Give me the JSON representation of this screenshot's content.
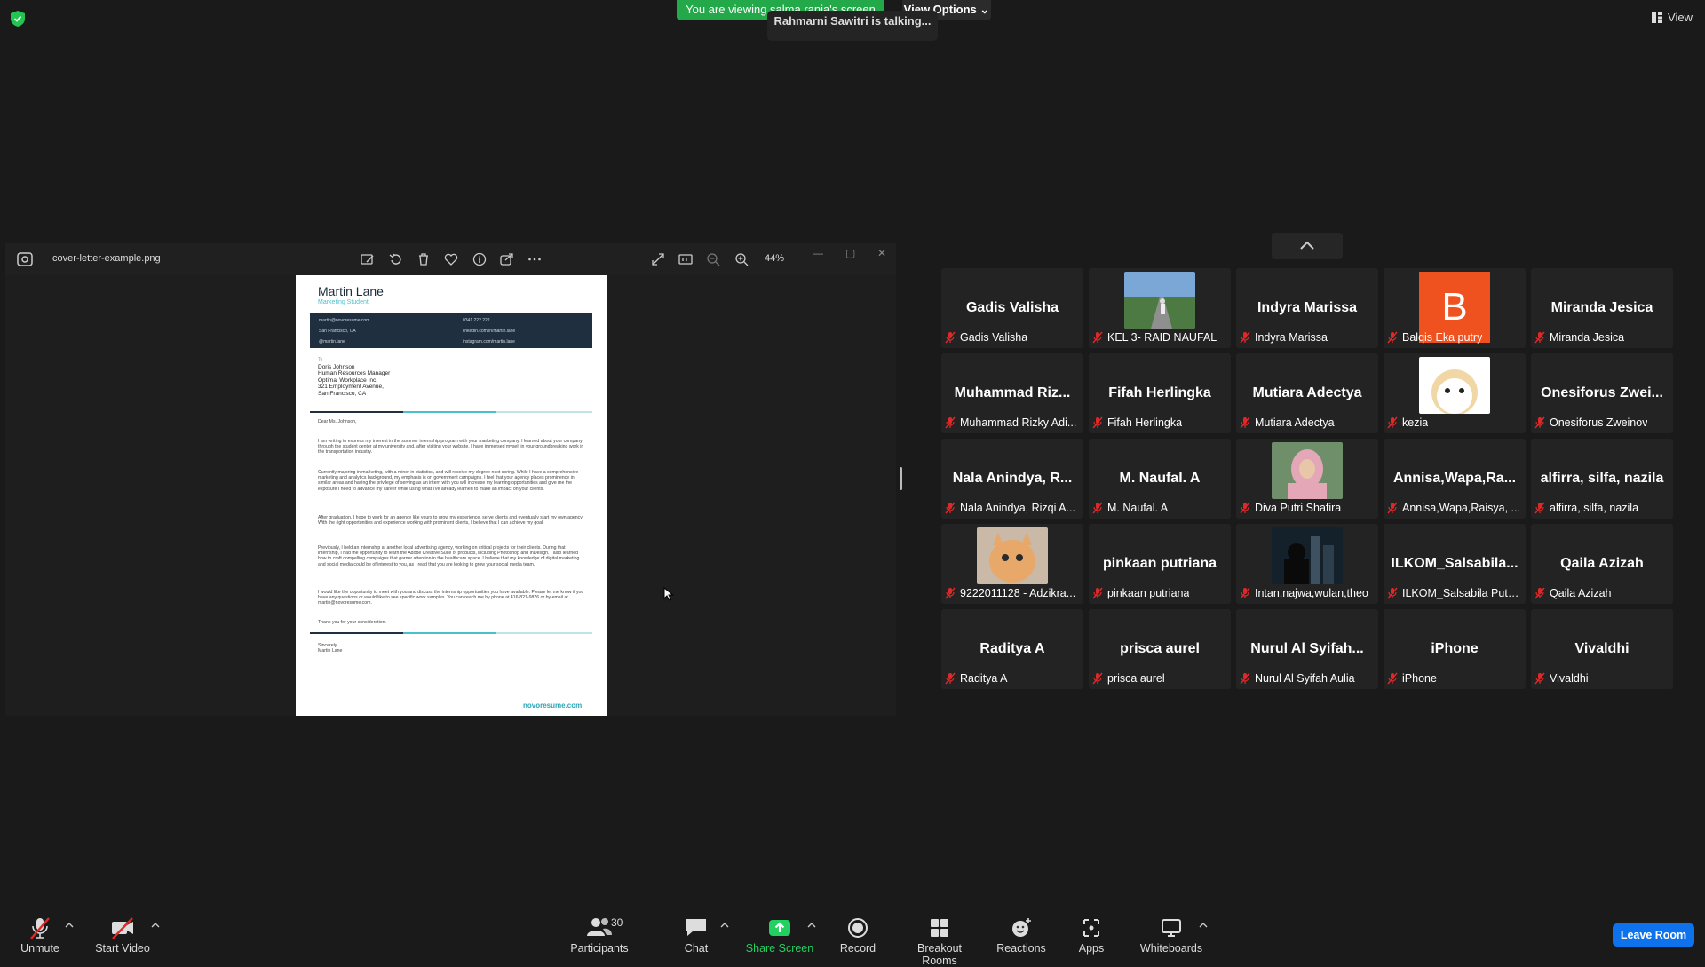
{
  "top_bar": {
    "viewing_banner": "You are viewing salma rania's screen",
    "view_options": "View Options",
    "talking": "Rahmarni Sawitri is talking...",
    "view_label": "View"
  },
  "viewer": {
    "filename": "cover-letter-example.png",
    "zoom": "44%"
  },
  "document": {
    "name": "Martin Lane",
    "role": "Marketing Student",
    "contacts": [
      "martin@novoresume.com",
      "0341 222 222",
      "San Francisco, CA",
      "linkedin.com/in/martin.lane",
      "@martin.lane",
      "instagram.com/martin.lane"
    ],
    "to_lines": [
      "To",
      "Doris Johnson",
      "Human Resources Manager",
      "Optimal Workplace Inc.",
      "321 Employment Avenue,",
      "San Francisco, CA"
    ],
    "greeting": "Dear Ms. Johnson,",
    "paragraphs": [
      "I am writing to express my interest in the summer internship program with your marketing company. I learned about your company through the student center at my university and, after visiting your website, I have immersed myself in your groundbreaking work in the transportation industry.",
      "Currently majoring in marketing, with a minor in statistics, and will receive my degree next spring. While I have a comprehensive marketing and analytics background, my emphasis is on government campaigns. I feel that your agency places prominence in similar areas and having the privilege of serving as an intern with you will increase my learning opportunities and give me the exposure I need to advance my career while using what I've already learned to make an impact on your clients.",
      "After graduation, I hope to work for an agency like yours to grow my experience, serve clients and eventually start my own agency. With the right opportunities and experience working with prominent clients, I believe that I can achieve my goal.",
      "Previously, I held an internship at another local advertising agency, working on critical projects for their clients. During that internship, I had the opportunity to learn the Adobe Creative Suite of products, including Photoshop and InDesign. I also learned how to craft compelling campaigns that garner attention in the healthcare space. I believe that my knowledge of digital marketing and social media could be of interest to you, as I read that you are looking to grow your social media team.",
      "I would like the opportunity to meet with you and discuss the internship opportunities you have available. Please let me know if you have any questions or would like to see specific work samples. You can reach me by phone at 416-821-9876 or by email at martin@novoresume.com.",
      "Thank you for your consideration."
    ],
    "signoff": [
      "Sincerely,",
      "Martin Lane"
    ],
    "logo": "novoresume.com"
  },
  "gallery": [
    {
      "big": "Gadis Valisha",
      "label": "Gadis Valisha"
    },
    {
      "big": "",
      "label": "KEL 3- RAID NAUFAL",
      "thumb": "photo-road"
    },
    {
      "big": "Indyra Marissa",
      "label": "Indyra Marissa"
    },
    {
      "big": "",
      "label": "Balqis Eka putry",
      "avatar": "B"
    },
    {
      "big": "Miranda Jesica",
      "label": "Miranda Jesica"
    },
    {
      "big": "Muhammad  Riz...",
      "label": "Muhammad Rizky Adi..."
    },
    {
      "big": "Fifah Herlingka",
      "label": "Fifah Herlingka"
    },
    {
      "big": "Mutiara Adectya",
      "label": "Mutiara Adectya"
    },
    {
      "big": "",
      "label": "kezia",
      "thumb": "photo-hamster"
    },
    {
      "big": "Onesiforus  Zwei...",
      "label": "Onesiforus Zweinov"
    },
    {
      "big": "Nala Anindya,  R...",
      "label": "Nala Anindya, Rizqi A..."
    },
    {
      "big": "M. Naufal. A",
      "label": "M. Naufal. A"
    },
    {
      "big": "",
      "label": "Diva Putri Shafira",
      "thumb": "photo-hijab"
    },
    {
      "big": "Annisa,Wapa,Ra...",
      "label": "Annisa,Wapa,Raisya, ..."
    },
    {
      "big": "alfirra, silfa, nazila",
      "label": "alfirra, silfa, nazila"
    },
    {
      "big": "",
      "label": "9222011128 - Adzikra...",
      "thumb": "photo-cat"
    },
    {
      "big": "pinkaan putriana",
      "label": "pinkaan putriana"
    },
    {
      "big": "",
      "label": "Intan,najwa,wulan,theo",
      "thumb": "photo-city"
    },
    {
      "big": "ILKOM_Salsabila...",
      "label": "ILKOM_Salsabila Putri..."
    },
    {
      "big": "Qaila Azizah",
      "label": "Qaila Azizah"
    },
    {
      "big": "Raditya A",
      "label": "Raditya A"
    },
    {
      "big": "prisca aurel",
      "label": "prisca aurel"
    },
    {
      "big": "Nurul Al Syifah...",
      "label": "Nurul Al Syifah Aulia"
    },
    {
      "big": "iPhone",
      "label": "iPhone"
    },
    {
      "big": "Vivaldhi",
      "label": "Vivaldhi"
    }
  ],
  "toolbar": {
    "unmute": "Unmute",
    "start_video": "Start Video",
    "participants": "Participants",
    "participants_count": "30",
    "chat": "Chat",
    "share_screen": "Share Screen",
    "record": "Record",
    "breakout": "Breakout Rooms",
    "reactions": "Reactions",
    "apps": "Apps",
    "whiteboards": "Whiteboards",
    "leave": "Leave Room"
  },
  "colors": {
    "accent_green": "#23a94a",
    "leave_blue": "#0e72ed",
    "mute_red": "#e02828",
    "share_green": "#23d160"
  }
}
